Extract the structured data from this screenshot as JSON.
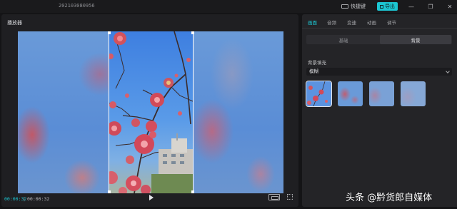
{
  "titlebar": {
    "project_name": "202103080956",
    "shortcut_label": "快捷键",
    "export_label": "导出"
  },
  "player": {
    "title": "播放器",
    "time_current": "00:00:32",
    "time_separator": "|",
    "time_total": "00:00:32"
  },
  "inspector": {
    "tabs": [
      {
        "label": "画面",
        "active": true
      },
      {
        "label": "音频",
        "active": false
      },
      {
        "label": "变速",
        "active": false
      },
      {
        "label": "动画",
        "active": false
      },
      {
        "label": "调节",
        "active": false
      }
    ],
    "segments": [
      {
        "label": "基础",
        "active": false
      },
      {
        "label": "背景",
        "active": true
      }
    ],
    "section_label": "背景填充",
    "fill_select_value": "模糊"
  },
  "watermark": "头条 @黔货郎自媒体",
  "colors": {
    "accent": "#1cc6d2",
    "panel_bg": "#1f1f22",
    "inspector_bg": "#242427",
    "app_bg": "#141416"
  },
  "icons": [
    "keyboard-icon",
    "export-icon",
    "minimize-icon",
    "maximize-icon",
    "close-icon",
    "play-icon",
    "aspect-ratio-icon",
    "fullscreen-icon",
    "chevron-down-icon"
  ]
}
